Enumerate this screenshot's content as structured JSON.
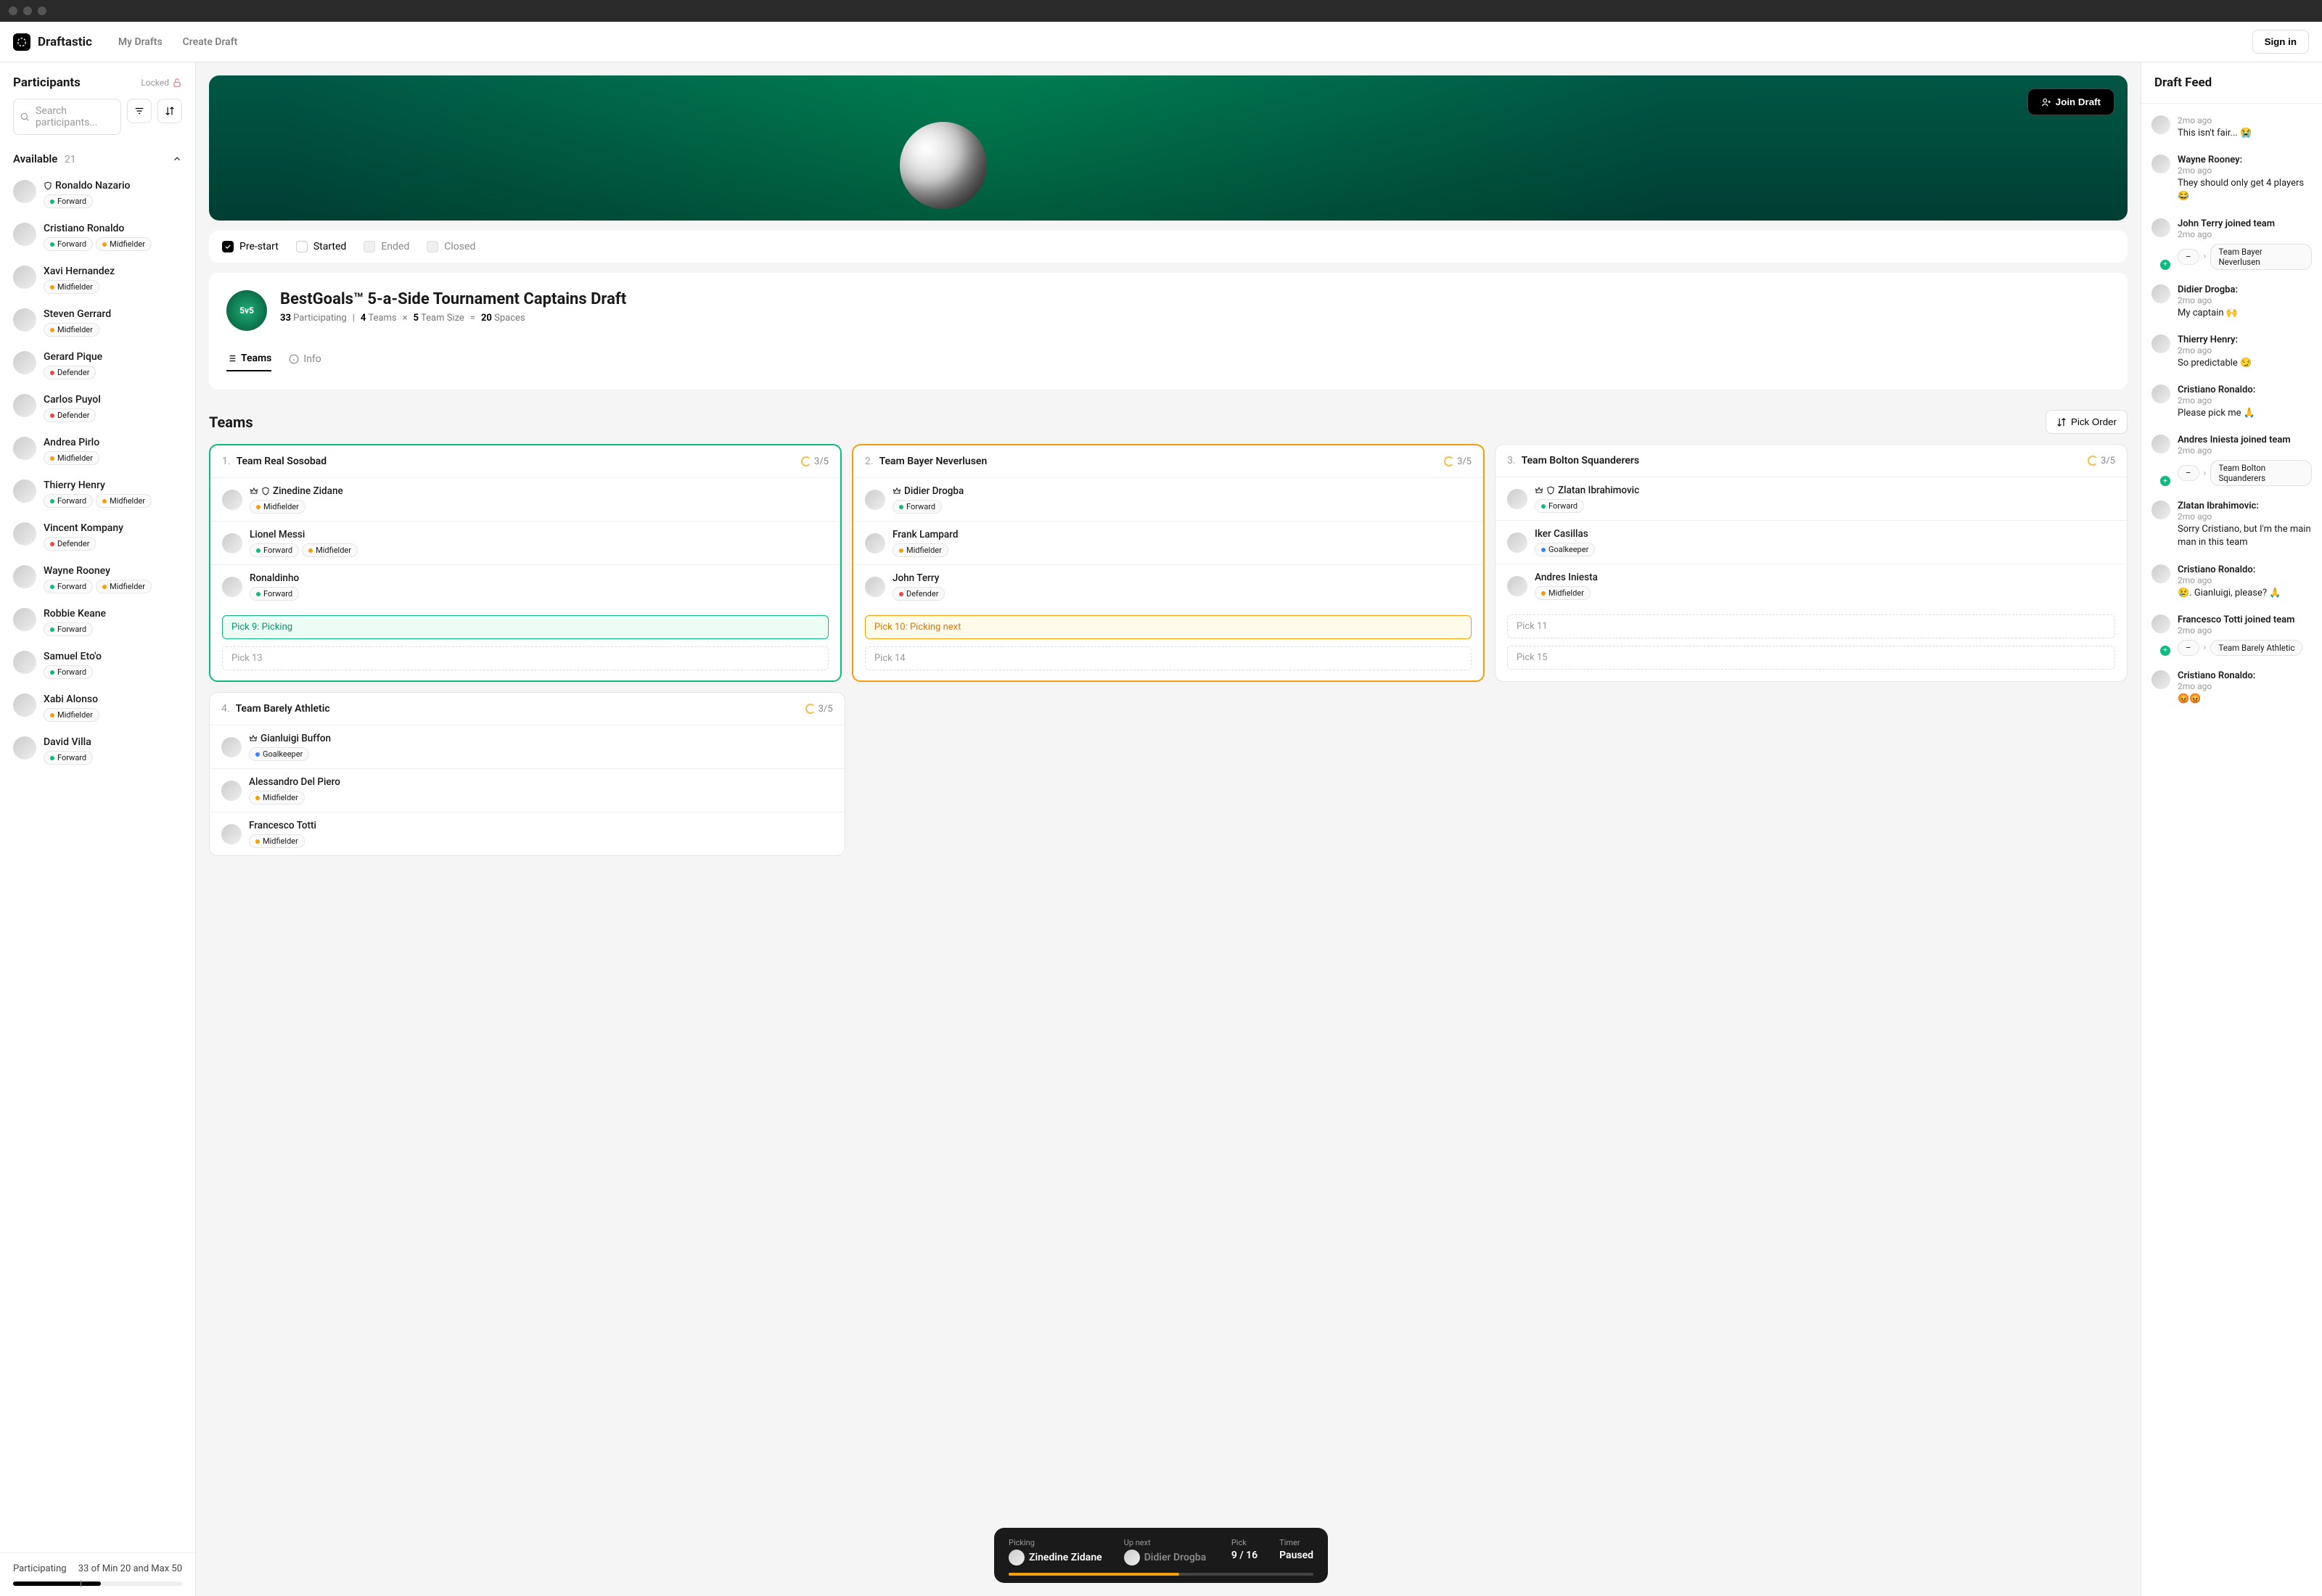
{
  "app": {
    "name": "Draftastic",
    "nav": [
      "My Drafts",
      "Create Draft"
    ],
    "signin": "Sign in"
  },
  "participants": {
    "title": "Participants",
    "lock": "Locked",
    "search_placeholder": "Search participants...",
    "available_label": "Available",
    "available_count": "21",
    "list": [
      {
        "name": "Ronaldo Nazario",
        "roles": [
          "Forward"
        ],
        "shield": true
      },
      {
        "name": "Cristiano Ronaldo",
        "roles": [
          "Forward",
          "Midfielder"
        ]
      },
      {
        "name": "Xavi Hernandez",
        "roles": [
          "Midfielder"
        ]
      },
      {
        "name": "Steven Gerrard",
        "roles": [
          "Midfielder"
        ]
      },
      {
        "name": "Gerard Pique",
        "roles": [
          "Defender"
        ]
      },
      {
        "name": "Carlos Puyol",
        "roles": [
          "Defender"
        ]
      },
      {
        "name": "Andrea Pirlo",
        "roles": [
          "Midfielder"
        ]
      },
      {
        "name": "Thierry Henry",
        "roles": [
          "Forward",
          "Midfielder"
        ]
      },
      {
        "name": "Vincent Kompany",
        "roles": [
          "Defender"
        ]
      },
      {
        "name": "Wayne Rooney",
        "roles": [
          "Forward",
          "Midfielder"
        ]
      },
      {
        "name": "Robbie Keane",
        "roles": [
          "Forward"
        ]
      },
      {
        "name": "Samuel Eto'o",
        "roles": [
          "Forward"
        ]
      },
      {
        "name": "Xabi Alonso",
        "roles": [
          "Midfielder"
        ]
      },
      {
        "name": "David Villa",
        "roles": [
          "Forward"
        ]
      }
    ],
    "footer": {
      "label": "Participating",
      "value": "33 of Min 20 and Max 50"
    }
  },
  "hero": {
    "join": "Join Draft"
  },
  "statuses": [
    {
      "label": "Pre-start",
      "state": "checked"
    },
    {
      "label": "Started",
      "state": "unchecked"
    },
    {
      "label": "Ended",
      "state": "disabled"
    },
    {
      "label": "Closed",
      "state": "disabled"
    }
  ],
  "draft": {
    "title": "BestGoals™ 5-a-Side Tournament Captains Draft",
    "logo_text": "5v5",
    "meta_parts": {
      "participating_n": "33",
      "participating_l": "Participating",
      "teams_n": "4",
      "teams_l": "Teams",
      "size_n": "5",
      "size_l": "Team Size",
      "spaces_n": "20",
      "spaces_l": "Spaces"
    },
    "tabs": {
      "teams": "Teams",
      "info": "Info"
    }
  },
  "teams_section": {
    "title": "Teams",
    "pick_order": "Pick Order"
  },
  "teams": [
    {
      "num": "1.",
      "name": "Team Real Sosobad",
      "count": "3/5",
      "border": "picking",
      "players": [
        {
          "name": "Zinedine Zidane",
          "roles": [
            "Midfielder"
          ],
          "crown": true,
          "shield": true
        },
        {
          "name": "Lionel Messi",
          "roles": [
            "Forward",
            "Midfielder"
          ]
        },
        {
          "name": "Ronaldinho",
          "roles": [
            "Forward"
          ]
        }
      ],
      "slots": [
        {
          "label": "Pick 9: Picking",
          "cls": "picking"
        },
        {
          "label": "Pick 13"
        }
      ]
    },
    {
      "num": "2.",
      "name": "Team Bayer Neverlusen",
      "count": "3/5",
      "border": "next",
      "players": [
        {
          "name": "Didier Drogba",
          "roles": [
            "Forward"
          ],
          "crown": true
        },
        {
          "name": "Frank Lampard",
          "roles": [
            "Midfielder"
          ]
        },
        {
          "name": "John Terry",
          "roles": [
            "Defender"
          ]
        }
      ],
      "slots": [
        {
          "label": "Pick 10: Picking next",
          "cls": "next"
        },
        {
          "label": "Pick 14"
        }
      ]
    },
    {
      "num": "3.",
      "name": "Team Bolton Squanderers",
      "count": "3/5",
      "players": [
        {
          "name": "Zlatan Ibrahimovic",
          "roles": [
            "Forward"
          ],
          "crown": true,
          "shield": true
        },
        {
          "name": "Iker Casillas",
          "roles": [
            "Goalkeeper"
          ]
        },
        {
          "name": "Andres Iniesta",
          "roles": [
            "Midfielder"
          ]
        }
      ],
      "slots": [
        {
          "label": "Pick 11"
        },
        {
          "label": "Pick 15"
        }
      ]
    },
    {
      "num": "4.",
      "name": "Team Barely Athletic",
      "count": "3/5",
      "players": [
        {
          "name": "Gianluigi Buffon",
          "roles": [
            "Goalkeeper"
          ],
          "crown": true
        },
        {
          "name": "Alessandro Del Piero",
          "roles": [
            "Midfielder"
          ]
        },
        {
          "name": "Francesco Totti",
          "roles": [
            "Midfielder"
          ]
        }
      ],
      "slots": []
    }
  ],
  "bottombar": {
    "picking_l": "Picking",
    "picking_v": "Zinedine Zidane",
    "next_l": "Up next",
    "next_v": "Didier Drogba",
    "pick_l": "Pick",
    "pick_v": "9 / 16",
    "timer_l": "Timer",
    "timer_v": "Paused"
  },
  "feed": {
    "title": "Draft Feed",
    "items": [
      {
        "author": "",
        "time": "2mo ago",
        "msg": "This isn't fair... 😭"
      },
      {
        "author": "Wayne Rooney:",
        "time": "2mo ago",
        "msg": "They should only get 4 players 😂"
      },
      {
        "author": "John Terry joined team",
        "time": "2mo ago",
        "transfer_from": "–",
        "transfer_to": "Team Bayer Neverlusen",
        "join": true
      },
      {
        "author": "Didier Drogba:",
        "time": "2mo ago",
        "msg": "My captain 🙌"
      },
      {
        "author": "Thierry Henry:",
        "time": "2mo ago",
        "msg": "So predictable 😏"
      },
      {
        "author": "Cristiano Ronaldo:",
        "time": "2mo ago",
        "msg": "Please pick me 🙏"
      },
      {
        "author": "Andres Iniesta joined team",
        "time": "2mo ago",
        "transfer_from": "–",
        "transfer_to": "Team Bolton Squanderers",
        "join": true
      },
      {
        "author": "Zlatan Ibrahimovic:",
        "time": "2mo ago",
        "msg": "Sorry Cristiano, but I'm the main man in this team"
      },
      {
        "author": "Cristiano Ronaldo:",
        "time": "2mo ago",
        "msg": "😢. Gianluigi, please? 🙏"
      },
      {
        "author": "Francesco Totti joined team",
        "time": "2mo ago",
        "transfer_from": "–",
        "transfer_to": "Team Barely Athletic",
        "join": true
      },
      {
        "author": "Cristiano Ronaldo:",
        "time": "2mo ago",
        "msg": "😡😡"
      }
    ]
  }
}
